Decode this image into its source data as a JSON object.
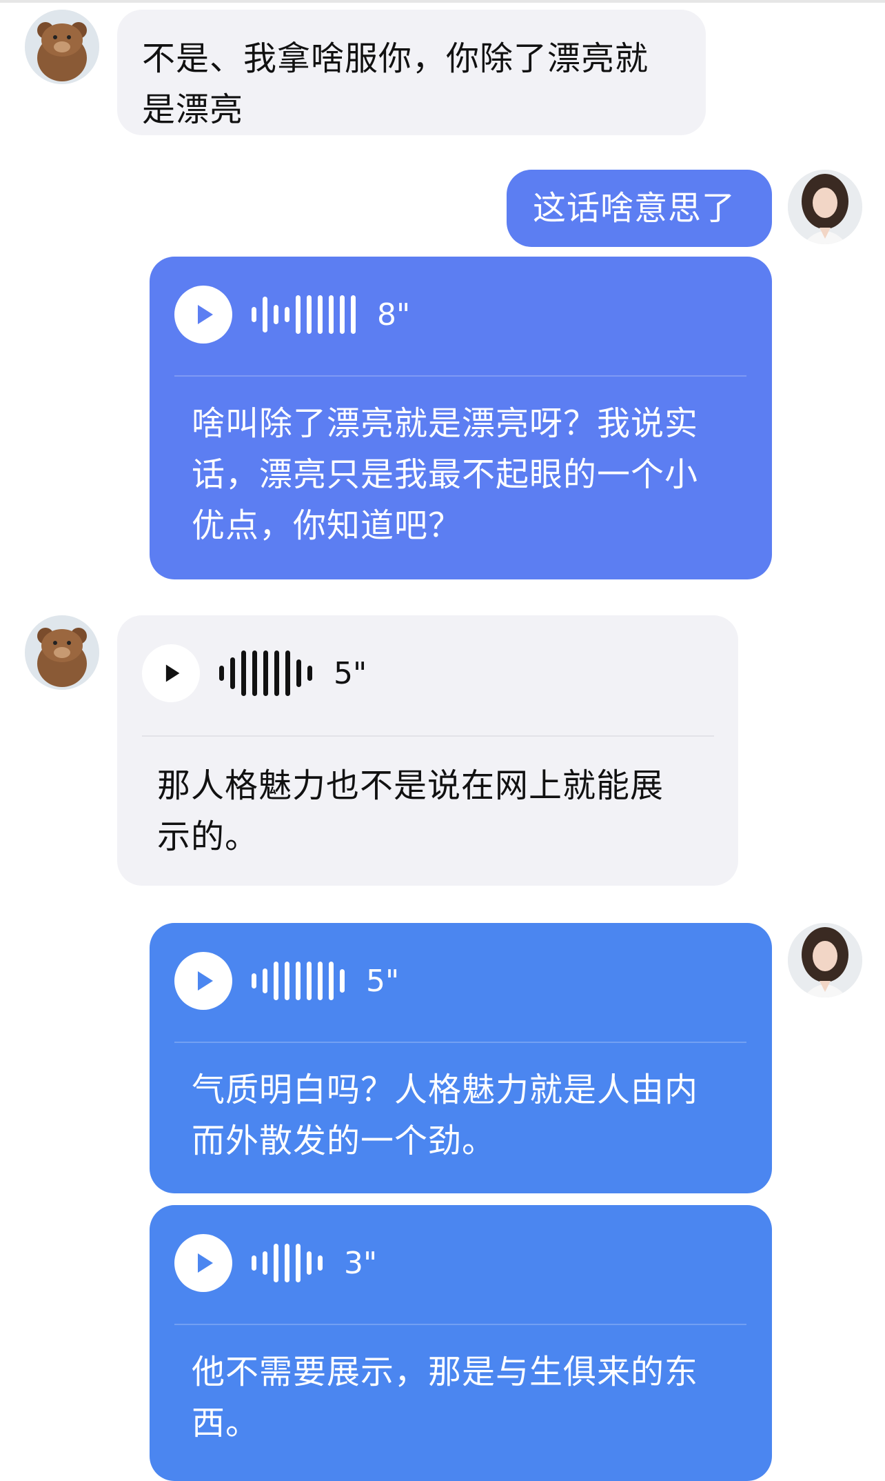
{
  "messages": [
    {
      "text": "不是、我拿啥服你，你除了漂亮就\n是漂亮"
    },
    {
      "text": "这话啥意思了"
    },
    {
      "duration": "8\"",
      "text": "啥叫除了漂亮就是漂亮呀？我说实\n话，漂亮只是我最不起眼的一个小\n优点，你知道吧？"
    },
    {
      "duration": "5\"",
      "text": "那人格魅力也不是说在网上就能展\n示的。"
    },
    {
      "duration": "5\"",
      "text": "气质明白吗？人格魅力就是人由内\n而外散发的一个劲。"
    },
    {
      "duration": "3\"",
      "text": "他不需要展示，那是与生俱来的东\n西。"
    }
  ],
  "colors": {
    "incoming_bubble": "#f2f2f6",
    "outgoing_bubble": "#5c7ef2",
    "outgoing_bubble_alt": "#4b86f0"
  },
  "icons": {
    "play": "play-icon",
    "waveform": "waveform-icon",
    "avatar_other": "bear-avatar",
    "avatar_self": "woman-avatar"
  }
}
